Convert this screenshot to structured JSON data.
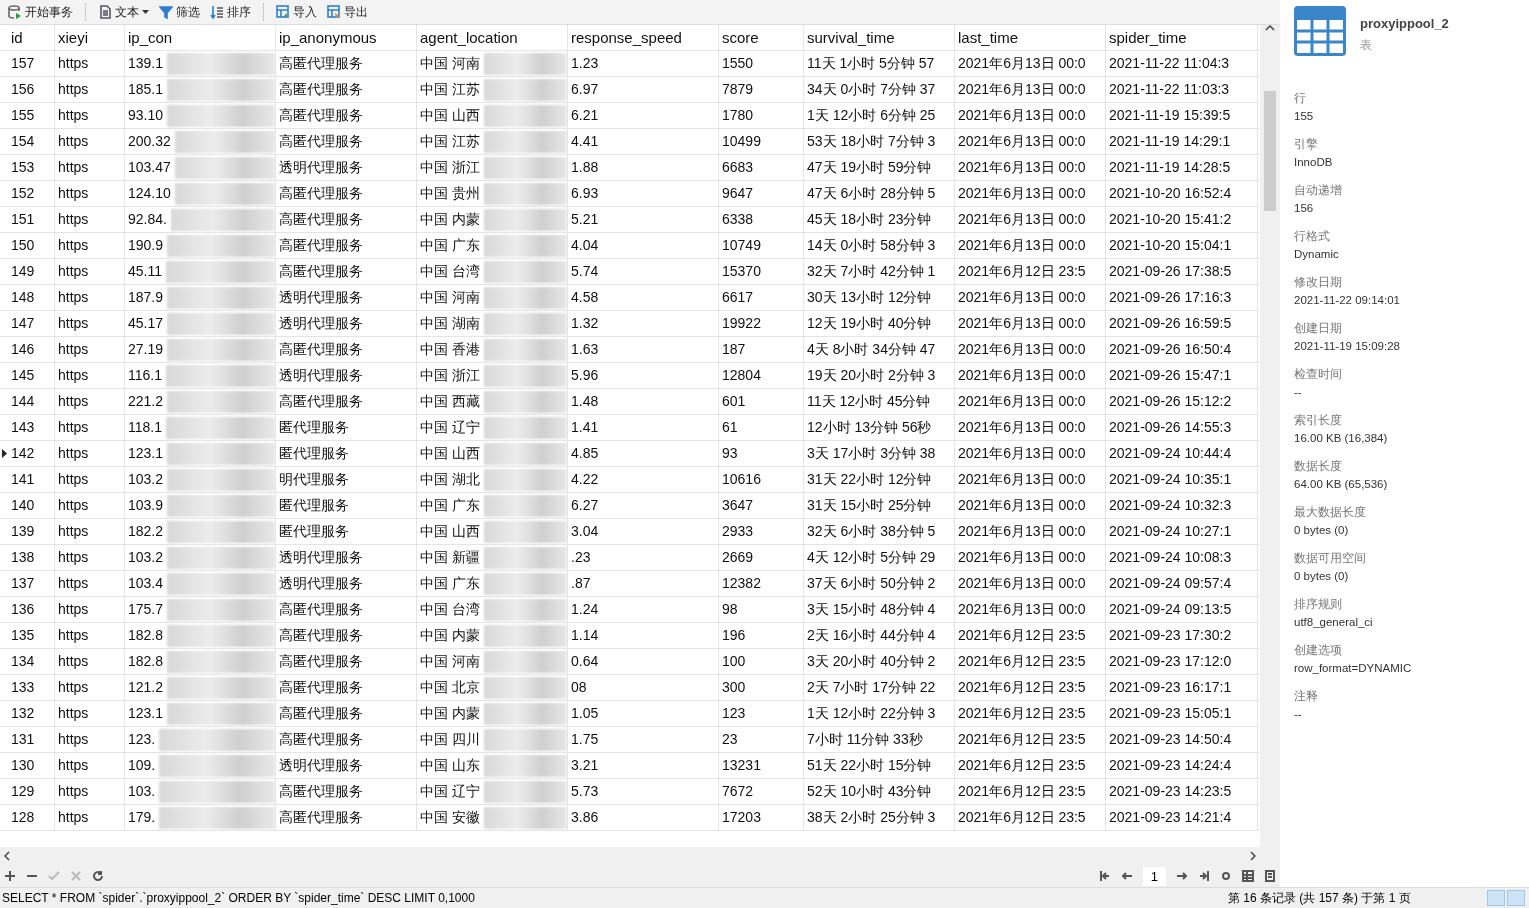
{
  "toolbar": [
    {
      "kind": "transaction",
      "label": "开始事务"
    },
    {
      "kind": "text",
      "label": "文本"
    },
    {
      "kind": "filter",
      "label": "筛选"
    },
    {
      "kind": "sort",
      "label": "排序"
    },
    {
      "kind": "import",
      "label": "导入"
    },
    {
      "kind": "export",
      "label": "导出"
    }
  ],
  "table": {
    "columns": [
      "id",
      "xieyi",
      "ip_con",
      "ip_anonymous",
      "agent_location",
      "response_speed",
      "score",
      "survival_time",
      "last_time",
      "spider_time"
    ],
    "rows": [
      {
        "current": false,
        "cells": [
          "157",
          "https",
          "139.1",
          "高匿代理服务",
          "中国 河南",
          "1.23",
          "1550",
          "11天 1小时 5分钟 57",
          "2021年6月13日 00:0",
          "2021-11-22 11:04:3"
        ]
      },
      {
        "current": false,
        "cells": [
          "156",
          "https",
          "185.1",
          "高匿代理服务",
          "中国 江苏",
          "6.97",
          "7879",
          "34天 0小时 7分钟 37",
          "2021年6月13日 00:0",
          "2021-11-22 11:03:3"
        ]
      },
      {
        "current": false,
        "cells": [
          "155",
          "https",
          "93.10",
          "高匿代理服务",
          "中国 山西",
          "6.21",
          "1780",
          "1天 12小时 6分钟 25",
          "2021年6月13日 00:0",
          "2021-11-19 15:39:5"
        ]
      },
      {
        "current": false,
        "cells": [
          "154",
          "https",
          "200.32",
          "高匿代理服务",
          "中国 江苏",
          "4.41",
          "10499",
          "53天 18小时 7分钟 3",
          "2021年6月13日 00:0",
          "2021-11-19 14:29:1"
        ]
      },
      {
        "current": false,
        "cells": [
          "153",
          "https",
          "103.47",
          "透明代理服务",
          "中国 浙江",
          "1.88",
          "6683",
          "47天 19小时 59分钟",
          "2021年6月13日 00:0",
          "2021-11-19 14:28:5"
        ]
      },
      {
        "current": false,
        "cells": [
          "152",
          "https",
          "124.10",
          "高匿代理服务",
          "中国 贵州",
          "6.93",
          "9647",
          "47天 6小时 28分钟 5",
          "2021年6月13日 00:0",
          "2021-10-20 16:52:4"
        ]
      },
      {
        "current": false,
        "cells": [
          "151",
          "https",
          "92.84.",
          "高匿代理服务",
          "中国 内蒙",
          "5.21",
          "6338",
          "45天 18小时 23分钟",
          "2021年6月13日 00:0",
          "2021-10-20 15:41:2"
        ]
      },
      {
        "current": false,
        "cells": [
          "150",
          "https",
          "190.9",
          "高匿代理服务",
          "中国 广东",
          "4.04",
          "10749",
          "14天 0小时 58分钟 3",
          "2021年6月13日 00:0",
          "2021-10-20 15:04:1"
        ]
      },
      {
        "current": false,
        "cells": [
          "149",
          "https",
          "45.11",
          "高匿代理服务",
          "中国 台湾",
          "5.74",
          "15370",
          "32天 7小时 42分钟 1",
          "2021年6月12日 23:5",
          "2021-09-26 17:38:5"
        ]
      },
      {
        "current": false,
        "cells": [
          "148",
          "https",
          "187.9",
          "透明代理服务",
          "中国 河南",
          "4.58",
          "6617",
          "30天 13小时 12分钟",
          "2021年6月13日 00:0",
          "2021-09-26 17:16:3"
        ]
      },
      {
        "current": false,
        "cells": [
          "147",
          "https",
          "45.17",
          "透明代理服务",
          "中国 湖南",
          "1.32",
          "19922",
          "12天 19小时 40分钟",
          "2021年6月13日 00:0",
          "2021-09-26 16:59:5"
        ]
      },
      {
        "current": false,
        "cells": [
          "146",
          "https",
          "27.19",
          "高匿代理服务",
          "中国 香港",
          "1.63",
          "187",
          "4天 8小时 34分钟 47",
          "2021年6月13日 00:0",
          "2021-09-26 16:50:4"
        ]
      },
      {
        "current": false,
        "cells": [
          "145",
          "https",
          "116.1",
          "透明代理服务",
          "中国 浙江",
          "5.96",
          "12804",
          "19天 20小时 2分钟 3",
          "2021年6月13日 00:0",
          "2021-09-26 15:47:1"
        ]
      },
      {
        "current": false,
        "cells": [
          "144",
          "https",
          "221.2",
          "高匿代理服务",
          "中国 西藏",
          "1.48",
          "601",
          "11天 12小时 45分钟",
          "2021年6月13日 00:0",
          "2021-09-26 15:12:2"
        ]
      },
      {
        "current": false,
        "cells": [
          "143",
          "https",
          "118.1",
          "匿代理服务",
          "中国 辽宁",
          "1.41",
          "61",
          "12小时 13分钟 56秒",
          "2021年6月13日 00:0",
          "2021-09-26 14:55:3"
        ]
      },
      {
        "current": true,
        "cells": [
          "142",
          "https",
          "123.1",
          "匿代理服务",
          "中国 山西",
          "4.85",
          "93",
          "3天 17小时 3分钟 38",
          "2021年6月13日 00:0",
          "2021-09-24 10:44:4"
        ]
      },
      {
        "current": false,
        "cells": [
          "141",
          "https",
          "103.2",
          "明代理服务",
          "中国 湖北",
          "4.22",
          "10616",
          "31天 22小时 12分钟",
          "2021年6月13日 00:0",
          "2021-09-24 10:35:1"
        ]
      },
      {
        "current": false,
        "cells": [
          "140",
          "https",
          "103.9",
          "匿代理服务",
          "中国 广东",
          "6.27",
          "3647",
          "31天 15小时 25分钟",
          "2021年6月13日 00:0",
          "2021-09-24 10:32:3"
        ]
      },
      {
        "current": false,
        "cells": [
          "139",
          "https",
          "182.2",
          "匿代理服务",
          "中国 山西",
          "3.04",
          "2933",
          "32天 6小时 38分钟 5",
          "2021年6月13日 00:0",
          "2021-09-24 10:27:1"
        ]
      },
      {
        "current": false,
        "cells": [
          "138",
          "https",
          "103.2",
          "透明代理服务",
          "中国 新疆",
          ".23",
          "2669",
          "4天 12小时 5分钟 29",
          "2021年6月13日 00:0",
          "2021-09-24 10:08:3"
        ]
      },
      {
        "current": false,
        "cells": [
          "137",
          "https",
          "103.4",
          "透明代理服务",
          "中国 广东",
          ".87",
          "12382",
          "37天 6小时 50分钟 2",
          "2021年6月13日 00:0",
          "2021-09-24 09:57:4"
        ]
      },
      {
        "current": false,
        "cells": [
          "136",
          "https",
          "175.7",
          "高匿代理服务",
          "中国 台湾",
          "1.24",
          "98",
          "3天 15小时 48分钟 4",
          "2021年6月13日 00:0",
          "2021-09-24 09:13:5"
        ]
      },
      {
        "current": false,
        "cells": [
          "135",
          "https",
          "182.8",
          "高匿代理服务",
          "中国 内蒙",
          "1.14",
          "196",
          "2天 16小时 44分钟 4",
          "2021年6月12日 23:5",
          "2021-09-23 17:30:2"
        ]
      },
      {
        "current": false,
        "cells": [
          "134",
          "https",
          "182.8",
          "高匿代理服务",
          "中国 河南",
          "0.64",
          "100",
          "3天 20小时 40分钟 2",
          "2021年6月12日 23:5",
          "2021-09-23 17:12:0"
        ]
      },
      {
        "current": false,
        "cells": [
          "133",
          "https",
          "121.2",
          "高匿代理服务",
          "中国 北京",
          "08",
          "300",
          "2天 7小时 17分钟 22",
          "2021年6月12日 23:5",
          "2021-09-23 16:17:1"
        ]
      },
      {
        "current": false,
        "cells": [
          "132",
          "https",
          "123.1",
          "高匿代理服务",
          "中国 内蒙",
          "1.05",
          "123",
          "1天 12小时 22分钟 3",
          "2021年6月12日 23:5",
          "2021-09-23 15:05:1"
        ]
      },
      {
        "current": false,
        "cells": [
          "131",
          "https",
          "123.",
          "高匿代理服务",
          "中国 四川",
          "1.75",
          "23",
          "7小时 11分钟 33秒",
          "2021年6月12日 23:5",
          "2021-09-23 14:50:4"
        ]
      },
      {
        "current": false,
        "cells": [
          "130",
          "https",
          "109.",
          "透明代理服务",
          "中国 山东",
          "3.21",
          "13231",
          "51天 22小时 15分钟",
          "2021年6月12日 23:5",
          "2021-09-23 14:24:4"
        ]
      },
      {
        "current": false,
        "cells": [
          "129",
          "https",
          "103.",
          "高匿代理服务",
          "中国 辽宁",
          "5.73",
          "7672",
          "52天 10小时 43分钟",
          "2021年6月12日 23:5",
          "2021-09-23 14:23:5"
        ]
      },
      {
        "current": false,
        "cells": [
          "128",
          "https",
          "179.",
          "高匿代理服务",
          "中国 安徽",
          "3.86",
          "17203",
          "38天 2小时 25分钟 3",
          "2021年6月12日 23:5",
          "2021-09-23 14:21:4"
        ]
      }
    ]
  },
  "pager": {
    "page": "1"
  },
  "sql": "SELECT * FROM `spider`.`proxyippool_2` ORDER BY `spider_time` DESC LIMIT 0,1000",
  "status": "第 16 条记录 (共 157 条) 于第 1 页",
  "info": {
    "name": "proxyippool_2",
    "type": "表",
    "fields": [
      {
        "label": "行",
        "value": "155"
      },
      {
        "label": "引擎",
        "value": "InnoDB"
      },
      {
        "label": "自动递增",
        "value": "156"
      },
      {
        "label": "行格式",
        "value": "Dynamic"
      },
      {
        "label": "修改日期",
        "value": "2021-11-22 09:14:01"
      },
      {
        "label": "创建日期",
        "value": "2021-11-19 15:09:28"
      },
      {
        "label": "检查时间",
        "value": "--"
      },
      {
        "label": "索引长度",
        "value": "16.00 KB (16,384)"
      },
      {
        "label": "数据长度",
        "value": "64.00 KB (65,536)"
      },
      {
        "label": "最大数据长度",
        "value": "0 bytes (0)"
      },
      {
        "label": "数据可用空间",
        "value": "0 bytes (0)"
      },
      {
        "label": "排序规则",
        "value": "utf8_general_ci"
      },
      {
        "label": "创建选项",
        "value": "row_format=DYNAMIC"
      },
      {
        "label": "注释",
        "value": "--"
      }
    ]
  }
}
